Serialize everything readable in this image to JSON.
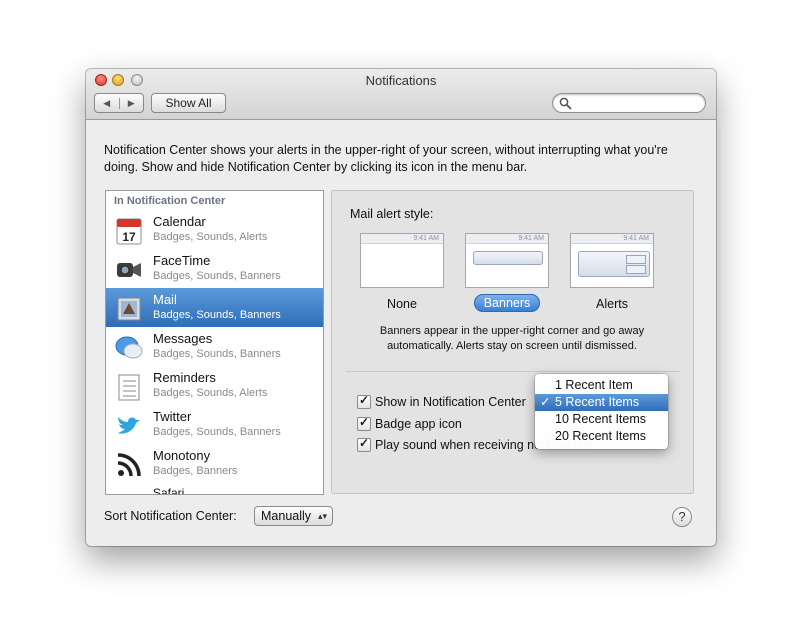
{
  "window": {
    "title": "Notifications"
  },
  "toolbar": {
    "back": "◀",
    "forward": "▶",
    "show_all": "Show All",
    "search_placeholder": ""
  },
  "intro_text": "Notification Center shows your alerts in the upper-right of your screen, without interrupting what you're doing. Show and hide Notification Center by clicking its icon in the menu bar.",
  "sidebar": {
    "header": "In Notification Center",
    "items": [
      {
        "name": "Calendar",
        "sub": "Badges, Sounds, Alerts",
        "icon": "calendar-icon",
        "date": "17"
      },
      {
        "name": "FaceTime",
        "sub": "Badges, Sounds, Banners",
        "icon": "facetime-icon"
      },
      {
        "name": "Mail",
        "sub": "Badges, Sounds, Banners",
        "icon": "mail-icon",
        "selected": true
      },
      {
        "name": "Messages",
        "sub": "Badges, Sounds, Banners",
        "icon": "messages-icon"
      },
      {
        "name": "Reminders",
        "sub": "Badges, Sounds, Alerts",
        "icon": "reminders-icon"
      },
      {
        "name": "Twitter",
        "sub": "Badges, Sounds, Banners",
        "icon": "twitter-icon"
      },
      {
        "name": "Monotony",
        "sub": "Badges, Banners",
        "icon": "rss-icon"
      }
    ],
    "partial_item": "Safari"
  },
  "detail": {
    "style_label": "Mail alert style:",
    "thumb_status": "9:41 AM",
    "styles": [
      "None",
      "Banners",
      "Alerts"
    ],
    "selected_style": "Banners",
    "description": "Banners appear in the upper-right corner and go away automatically. Alerts stay on screen until dismissed.",
    "checkboxes": [
      {
        "label": "Show in Notification Center",
        "checked": true
      },
      {
        "label": "Badge app icon",
        "checked": true
      },
      {
        "label": "Play sound when receiving notifications",
        "checked": true
      }
    ]
  },
  "recent_menu": {
    "options": [
      "1 Recent Item",
      "5 Recent Items",
      "10 Recent Items",
      "20 Recent Items"
    ],
    "selected": "5 Recent Items",
    "check": "✓"
  },
  "sort": {
    "label": "Sort Notification Center:",
    "value": "Manually",
    "arrows": "▴▾"
  },
  "help": "?",
  "colors": {
    "selection": "#3a7bc8",
    "window": "#ededed"
  }
}
